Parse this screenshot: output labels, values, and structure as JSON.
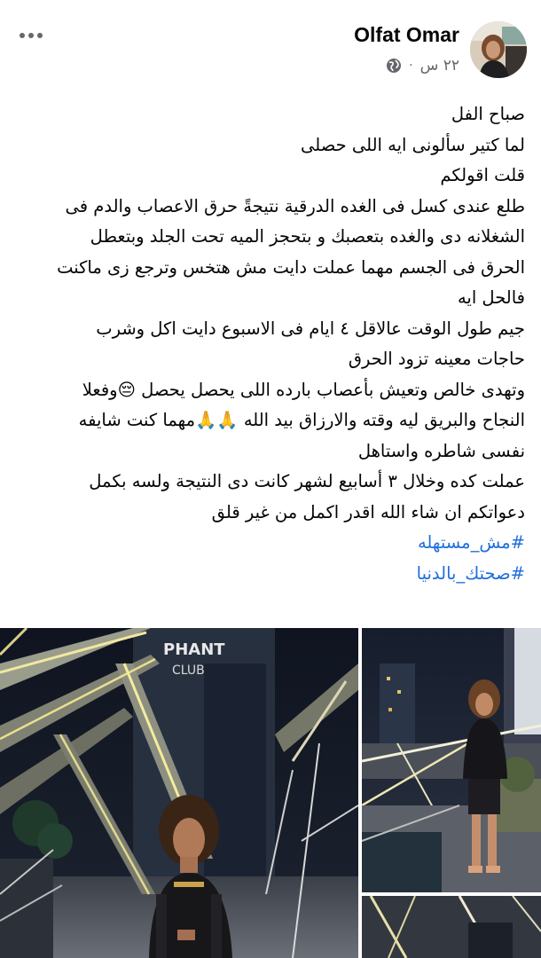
{
  "post": {
    "author": "Olfat Omar",
    "time": "٢٢ س",
    "separator": "·",
    "privacy_icon": "globe-icon",
    "more_icon": "more-horizontal-icon",
    "lines": [
      "صباح الفل",
      "لما كتير سألونى ايه اللى حصلى",
      "قلت اقولكم",
      "طلع عندى كسل فى الغده الدرقية نتيجةً حرق الاعصاب والدم فى",
      "الشغلانه دى والغده بتعصبك و بتحجز الميه تحت الجلد وبتعطل",
      "الحرق فى الجسم مهما عملت دايت مش هتخس وترجع زى ماكنت",
      "فالحل ايه",
      "جيم طول الوقت عالاقل ٤ ايام فى الاسبوع دايت اكل  وشرب",
      "حاجات معينه تزود الحرق",
      "وتهدى خالص وتعيش بأعصاب بارده اللى يحصل يحصل 😔وفعلا",
      "النجاح والبريق ليه وقته والارزاق بيد الله 🙏🙏مهما كنت شايفه",
      "نفسى شاطره واستاهل",
      "عملت كده وخلال ٣ أسابيع لشهر كانت دى النتيجة ولسه بكمل",
      "دعواتكم ان شاء الله اقدر اكمل من غير قلق"
    ],
    "hashtags": [
      "#مش_مستهله",
      "#صحتك_بالدنيا"
    ]
  },
  "photos": {
    "main_sign": "PHANT\nCLUB",
    "side_sign": "",
    "count": 3
  },
  "colors": {
    "hashtag": "#216fdb",
    "secondary_text": "#65676b",
    "text": "#050505"
  }
}
